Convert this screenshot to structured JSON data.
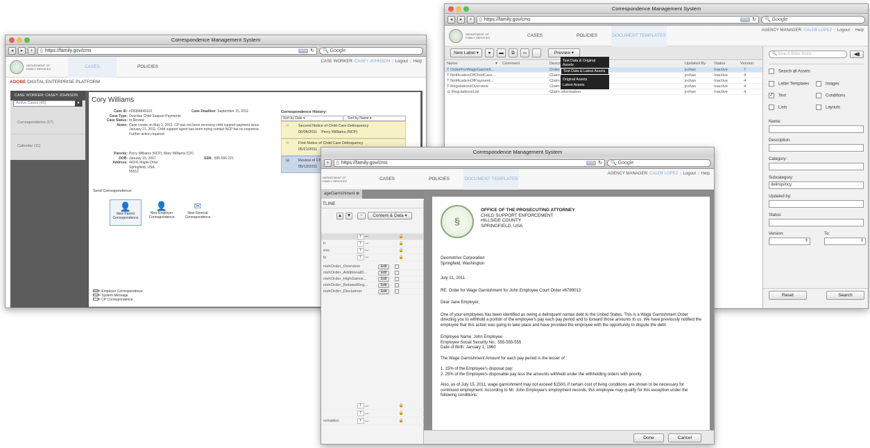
{
  "common": {
    "window_title": "Correspondence Management System",
    "url": "https://family.gov/cms",
    "search_placeholder": "Google",
    "rss": "RSS",
    "dept_line1": "DEPARTMENT OF",
    "dept_line2": "FAMILY SERVICES",
    "logout": "Logout",
    "help": "Help"
  },
  "left_window": {
    "tabs": [
      "CASES",
      "POLICIES"
    ],
    "caseworker_label": "CASE WORKER:",
    "caseworker_name": "CASEY JOHNSON",
    "platform_brand": "ADOBE",
    "platform_name": "DIGITAL ENTERPRISE PLATFORM",
    "sidebar_title": "CASE WORKER: CASEY JOHNSON",
    "filter_value": "Active Cases (45)",
    "sidebar_items": [
      "Correspondence (17)",
      "Calendar (11)"
    ],
    "client_name": "Cory Williams",
    "case_id_label": "Case ID:",
    "case_id": "#28384849102",
    "deadline_label": "Case Deadline:",
    "deadline": "September 15, 2011",
    "case_type_label": "Case Type:",
    "case_type": "Overdue Child Support Payments",
    "case_status_label": "Case Status:",
    "case_status": "In Review",
    "notes_label": "Notes:",
    "notes": "Case create on May 1, 2011. CP has not been receiving child support payment since January 21, 2011. Child support agent has been trying contact NCP but no response. Further action required.",
    "parents_label": "Parents:",
    "parents": "Perry Williams (NCP), Mary Williams (CP)",
    "dob_label": "DOB:",
    "dob": "January 15, 2007",
    "ssn_label": "SSN:",
    "ssn": "555-555-221",
    "address_label": "Address:",
    "address_lines": [
      "44241 Maple Drive",
      "Springfield, USA",
      "55512"
    ],
    "send_title": "Send Correspondence:",
    "send_options": [
      {
        "line1": "New Parent",
        "line2": "Correspondence",
        "icon": "parent-icon"
      },
      {
        "line1": "New Employer",
        "line2": "Correspondence",
        "icon": "employer-icon"
      },
      {
        "line1": "New General",
        "line2": "Correspondence",
        "icon": "envelope-icon"
      }
    ],
    "history_title": "Correspondence History:",
    "sort_date": "Sort by Date",
    "sort_name": "Sort by Name",
    "history": [
      {
        "title": "Second Notice of Child Care Delinquency",
        "date": "06/06/2011",
        "who": "Perry Williams (NCP)"
      },
      {
        "title": "First Notice of Child Care Delinquency",
        "date": "05/21/2011",
        "who": ""
      },
      {
        "title": "Review of Chi",
        "date": "05/13/2011",
        "who": ""
      }
    ],
    "legend": [
      "= Employer Correspondence",
      "= System Message",
      "= CP Correspondence"
    ]
  },
  "right_window": {
    "tabs": [
      "CASES",
      "POLICIES",
      "DOCUMENT TEMPLATES"
    ],
    "manager_label": "AGENCY MANAGER:",
    "manager_name": "CALEB LOPEZ",
    "new_label": "New Label",
    "preview": "Preview",
    "preview_menu": [
      "Test Data & Original Assets",
      "Test Data & Latest Assets",
      "Original Assets",
      "Latest Assets"
    ],
    "columns": [
      "Name",
      "Comment",
      "Description",
      "Updated By",
      "Status",
      "Version"
    ],
    "rows": [
      {
        "name": "OrderForWageGarnish...",
        "desc": "Order",
        "by": "jrohan",
        "status": "Inactive",
        "ver": "7"
      },
      {
        "name": "NotificationOfChildCare...",
        "desc": "Claim",
        "by": "jrohan",
        "status": "Inactive",
        "ver": "4"
      },
      {
        "name": "NotificationOfPayment...",
        "desc": "Claim",
        "by": "jrohan",
        "status": "Inactive",
        "ver": "4"
      },
      {
        "name": "RegulationsOverview",
        "desc": "Claim",
        "by": "jrohan",
        "status": "Inactive",
        "ver": "4"
      },
      {
        "name": "RegulationsList",
        "desc": "Claim information",
        "by": "jrohan",
        "status": "Inactive",
        "ver": "4"
      }
    ],
    "search_placeholder": "Search Enter Terms",
    "search_all": "Search all Assets",
    "filters": [
      {
        "label": "Letter Templates",
        "checked": false
      },
      {
        "label": "Images",
        "checked": false
      },
      {
        "label": "Text",
        "checked": true
      },
      {
        "label": "Conditions",
        "checked": false
      },
      {
        "label": "Lists",
        "checked": false
      },
      {
        "label": "Layouts",
        "checked": false
      }
    ],
    "fields": [
      {
        "label": "Name:",
        "value": ""
      },
      {
        "label": "Description:",
        "value": ""
      },
      {
        "label": "Category:",
        "value": ""
      },
      {
        "label": "Subcategory:",
        "value": "delinquincy"
      },
      {
        "label": "Updated by:",
        "value": ""
      },
      {
        "label": "Status:",
        "value": ""
      }
    ],
    "version_label": "Version:",
    "to_label": "To:",
    "reset": "Reset",
    "search": "Search"
  },
  "front_window": {
    "tabs": [
      "CASES",
      "POLICIES",
      "DOCUMENT TEMPLATES"
    ],
    "doc_tab": "ageGarnishment",
    "outline_title": "TLINE",
    "content_mode": "Content & Data",
    "outline_rows": [
      {
        "label": "h"
      },
      {
        "label": "ess"
      },
      {
        "label": "ly"
      }
    ],
    "module_rows": [
      "nishOrder_Overview",
      "nishOrder_AdditionalD...",
      "nishOrder_HighGarnis...",
      "nishOrder_RelatedReg...",
      "nishOrder_Disclaimer"
    ],
    "edit": "Edit",
    "bottom_rows": [
      "",
      "",
      "ormation"
    ],
    "letter": {
      "office": "OFFICE OF THE PROSECUTING ATTORNEY",
      "office_lines": [
        "CHILD SUPPORT ENFORCEMENT",
        "HILLSIDE COUNTY",
        "SPRINGFIELD, USA"
      ],
      "recipient": [
        "Geometrixx Corporation",
        "Springfield, Washington"
      ],
      "date": "July 21, 2011",
      "re": "RE: Order for Wage Garnishment for John Employee Court Order  #6789013",
      "salutation": "Dear Jane Employer,",
      "para1": "One of your employees has been identified as owing a delinquent nontax debt to the United States. This is a Wage Garnishment Order directing you to withhold a portion of the employee's pay each pay period and to forward those amounts to us. We have previously notified the employee that this action was going to take place and have provided the employee with the opportunity to dispute the debt.",
      "employee": [
        "Employee  Name: John Employee",
        "Employee Social Security No.: 555-555-555",
        "Date of Birth: January 1, 1960"
      ],
      "amount_line": "The Wage Garnishment Amount for each pay period is the lesser of :",
      "list": [
        "1.  15% of the Employee's disposal pay;",
        "2.  25% of the Employee's disposable pay less the amounts withheld under the withholding orders with priority."
      ],
      "para2": "Also, as of July 15, 2011, wage garnishment may not exceed $1500, if certain cost of living conditions are shown to be necessary for continued employment. According to Mr. John Employee's employment records, this employee may qualify for this exception under the following conditions:",
      "seal_text": "HILLSIDE COUNTY"
    },
    "done": "Done",
    "cancel": "Cancel"
  }
}
